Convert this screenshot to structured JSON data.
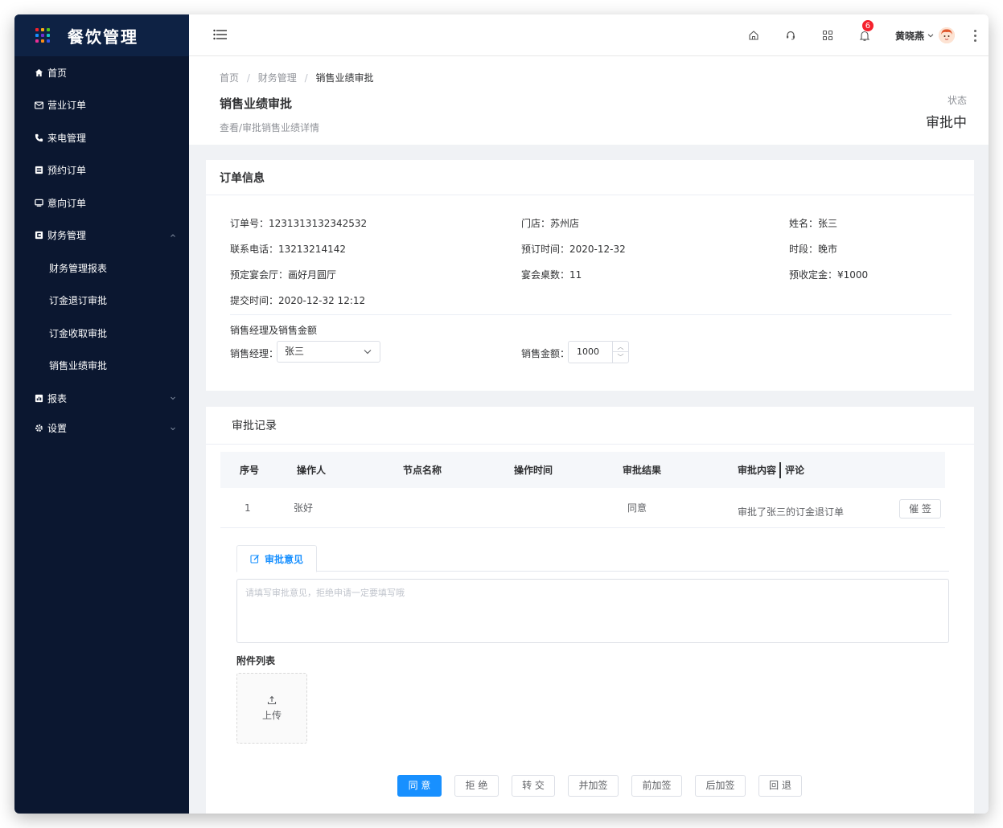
{
  "app": {
    "title": "餐饮管理",
    "logo_colors": [
      "#f5222d",
      "#faad14",
      "#52c41a",
      "#1890ff",
      "#722ed1",
      "#13c2c2",
      "#eb2f96",
      "#fa8c16",
      "#2f54eb"
    ]
  },
  "sidebar": {
    "items": [
      {
        "label": "首页",
        "icon": "home-icon"
      },
      {
        "label": "营业订单",
        "icon": "mail-icon"
      },
      {
        "label": "来电管理",
        "icon": "phone-icon"
      },
      {
        "label": "预约订单",
        "icon": "list-icon"
      },
      {
        "label": "意向订单",
        "icon": "monitor-icon"
      },
      {
        "label": "财务管理",
        "icon": "finance-icon",
        "expanded": true
      }
    ],
    "finance_sub": [
      "财务管理报表",
      "订金退订审批",
      "订金收取审批",
      "销售业绩审批"
    ],
    "tail_items": [
      {
        "label": "报表",
        "icon": "chart-icon"
      },
      {
        "label": "设置",
        "icon": "gear-icon"
      }
    ]
  },
  "topbar": {
    "notification_count": "6",
    "username": "黄晓燕"
  },
  "header": {
    "breadcrumb": [
      "首页",
      "财务管理",
      "销售业绩审批"
    ],
    "title": "销售业绩审批",
    "subtitle": "查看/审批销售业绩详情",
    "status_label": "状态",
    "status_value": "审批中"
  },
  "order": {
    "title": "订单信息",
    "order_no": "订单号：1231313132342532",
    "store": "门店：苏州店",
    "name": "姓名：张三",
    "phone": "联系电话：13213214142",
    "book_time": "预订时间：2020-12-32",
    "period": "时段：晚市",
    "hall": "预定宴会厅：画好月圆厅",
    "tables": "宴会桌数：11",
    "deposit": "预收定金：¥1000",
    "submit_time": "提交时间：2020-12-32 12:12",
    "sales_section": "销售经理及销售金额",
    "manager_label": "销售经理：",
    "manager_value": "张三",
    "amount_label": "销售金额：",
    "amount_value": "1000"
  },
  "records": {
    "title": "审批记录",
    "headers": [
      "序号",
      "操作人",
      "节点名称",
      "操作时间",
      "审批结果",
      "审批内容",
      "评论"
    ],
    "rows": [
      {
        "index": "1",
        "operator": "张好",
        "node": "",
        "time": "",
        "result": "同意",
        "content": "审批了张三的订金退订单",
        "action": "催 签"
      }
    ],
    "opinion_tab": "审批意见",
    "opinion_placeholder": "请填写审批意见，拒绝申请一定要填写哦",
    "attach_title": "附件列表",
    "upload_label": "上传"
  },
  "actions": [
    "同 意",
    "拒 绝",
    "转 交",
    "并加签",
    "前加签",
    "后加签",
    "回 退"
  ],
  "colors": {
    "sidebar_bg": "#0b1730",
    "logo_bar_bg": "#0e2244",
    "primary": "#1890ff",
    "badge": "#f5222d"
  }
}
